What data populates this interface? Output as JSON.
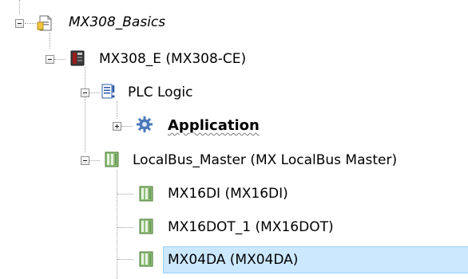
{
  "colors": {
    "selection_fill": "#cce8ff",
    "selection_border": "#99d1ff",
    "tree_line": "#a0a0a0",
    "application_gear": "#4a78b8"
  },
  "tree": {
    "project": {
      "label": "MX308_Basics",
      "icon": "project-file-icon",
      "expanded": true
    },
    "device": {
      "label": "MX308_E (MX308-CE)",
      "icon": "controller-device-icon",
      "expanded": true
    },
    "plc_logic": {
      "label": "PLC Logic",
      "icon": "plc-logic-icon",
      "expanded": true
    },
    "application": {
      "label": "Application",
      "icon": "application-gear-icon",
      "expanded": false
    },
    "localbus": {
      "label": "LocalBus_Master (MX LocalBus Master)",
      "icon": "bus-module-icon",
      "expanded": true
    },
    "modules": [
      {
        "label": "MX16DI (MX16DI)",
        "icon": "io-module-icon",
        "selected": false
      },
      {
        "label": "MX16DOT_1 (MX16DOT)",
        "icon": "io-module-icon",
        "selected": false
      },
      {
        "label": "MX04DA (MX04DA)",
        "icon": "io-module-icon",
        "selected": true
      }
    ]
  }
}
